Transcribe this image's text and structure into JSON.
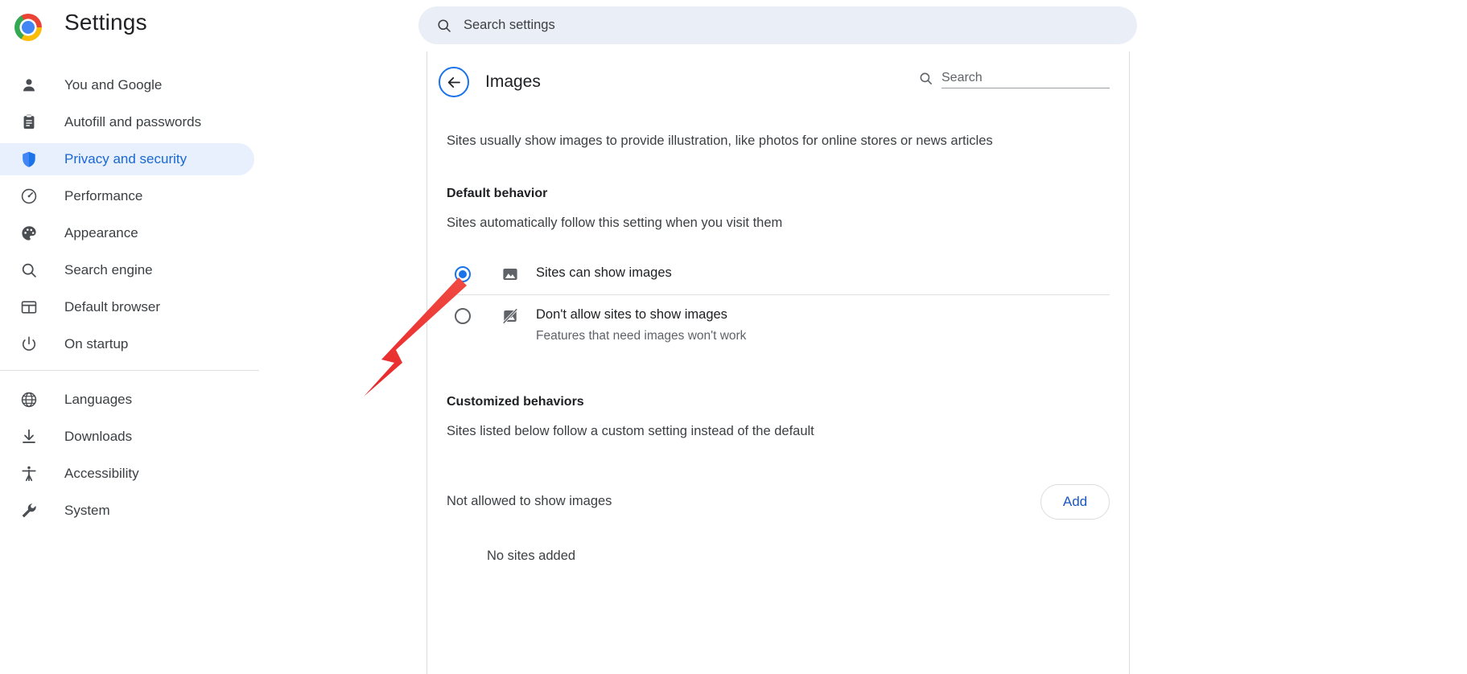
{
  "topbar": {
    "app_title": "Settings",
    "logo_icon": "chrome-logo-icon",
    "search": {
      "icon": "search-icon",
      "placeholder": "Search settings",
      "value": ""
    }
  },
  "sidebar": {
    "groups": [
      {
        "items": [
          {
            "label": "You and Google",
            "icon": "person-icon",
            "active": false
          },
          {
            "label": "Autofill and passwords",
            "icon": "clipboard-icon",
            "active": false
          },
          {
            "label": "Privacy and security",
            "icon": "shield-icon",
            "active": true
          },
          {
            "label": "Performance",
            "icon": "speedometer-icon",
            "active": false
          },
          {
            "label": "Appearance",
            "icon": "palette-icon",
            "active": false
          },
          {
            "label": "Search engine",
            "icon": "search-icon",
            "active": false
          },
          {
            "label": "Default browser",
            "icon": "browser-window-icon",
            "active": false
          },
          {
            "label": "On startup",
            "icon": "power-icon",
            "active": false
          }
        ]
      },
      {
        "items": [
          {
            "label": "Languages",
            "icon": "globe-icon",
            "active": false
          },
          {
            "label": "Downloads",
            "icon": "download-icon",
            "active": false
          },
          {
            "label": "Accessibility",
            "icon": "accessibility-icon",
            "active": false
          },
          {
            "label": "System",
            "icon": "wrench-icon",
            "active": false
          }
        ]
      }
    ]
  },
  "main": {
    "back_icon": "back-arrow-icon",
    "page_title": "Images",
    "search": {
      "icon": "search-icon",
      "placeholder": "Search",
      "value": ""
    },
    "intro": "Sites usually show images to provide illustration, like photos for online stores or news articles",
    "default_behavior": {
      "heading": "Default behavior",
      "subtext": "Sites automatically follow this setting when you visit them",
      "options": [
        {
          "label": "Sites can show images",
          "description": "",
          "icon": "image-icon",
          "selected": true
        },
        {
          "label": "Don't allow sites to show images",
          "description": "Features that need images won't work",
          "icon": "image-blocked-icon",
          "selected": false
        }
      ]
    },
    "customized_behaviors": {
      "heading": "Customized behaviors",
      "subtext": "Sites listed below follow a custom setting instead of the default",
      "not_allowed_label": "Not allowed to show images",
      "add_label": "Add",
      "empty_label": "No sites added"
    }
  },
  "annotation": {
    "arrow_color": "#e8262a",
    "points_to": "sites-can-show-images-radio"
  },
  "colors": {
    "accent_blue": "#1a73e8",
    "active_bg": "#e8f0fe",
    "search_bg": "#eaeef6",
    "text_primary": "#202124",
    "text_secondary": "#5f6368",
    "border": "#dadce0"
  }
}
